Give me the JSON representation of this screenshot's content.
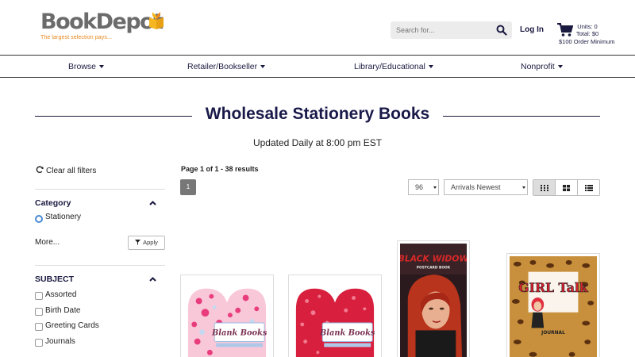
{
  "header": {
    "logo_text": "BookDepot",
    "logo_tagline": "The largest selection pays...",
    "search_placeholder": "Search for...",
    "login_label": "Log In",
    "cart_units": "Units: 0",
    "cart_total": "Total: $0",
    "cart_minimum": "$100 Order Minimum"
  },
  "nav": {
    "items": [
      {
        "label": "Browse"
      },
      {
        "label": "Retailer/Bookseller"
      },
      {
        "label": "Library/Educational"
      },
      {
        "label": "Nonprofit"
      }
    ]
  },
  "page": {
    "title": "Wholesale Stationery Books",
    "updated": "Updated Daily at 8:00 pm EST"
  },
  "sidebar": {
    "clear_label": "Clear all filters",
    "category_heading": "Category",
    "category_selected": "Stationery",
    "more_label": "More...",
    "apply_label": "Apply",
    "subject_heading": "SUBJECT",
    "subjects": [
      "Assorted",
      "Birth Date",
      "Greeting Cards",
      "Journals"
    ]
  },
  "results": {
    "page_info": "Page 1 of 1 - 38 results",
    "current_page": "1",
    "per_page": "96",
    "sort": "Arrivals Newest"
  },
  "products": [
    {
      "cover_text": "Blank Books"
    },
    {
      "cover_text": "Blank Books"
    },
    {
      "cover_text": "BLACK WIDOW",
      "cover_sub": "POSTCARD BOOK"
    },
    {
      "cover_text": "GIRL Talk",
      "cover_sub": "JOURNAL"
    }
  ],
  "colors": {
    "navy": "#1a1a40",
    "logo_orange": "#e8871e",
    "logo_yellow": "#f5b622",
    "page_btn": "#777777"
  }
}
